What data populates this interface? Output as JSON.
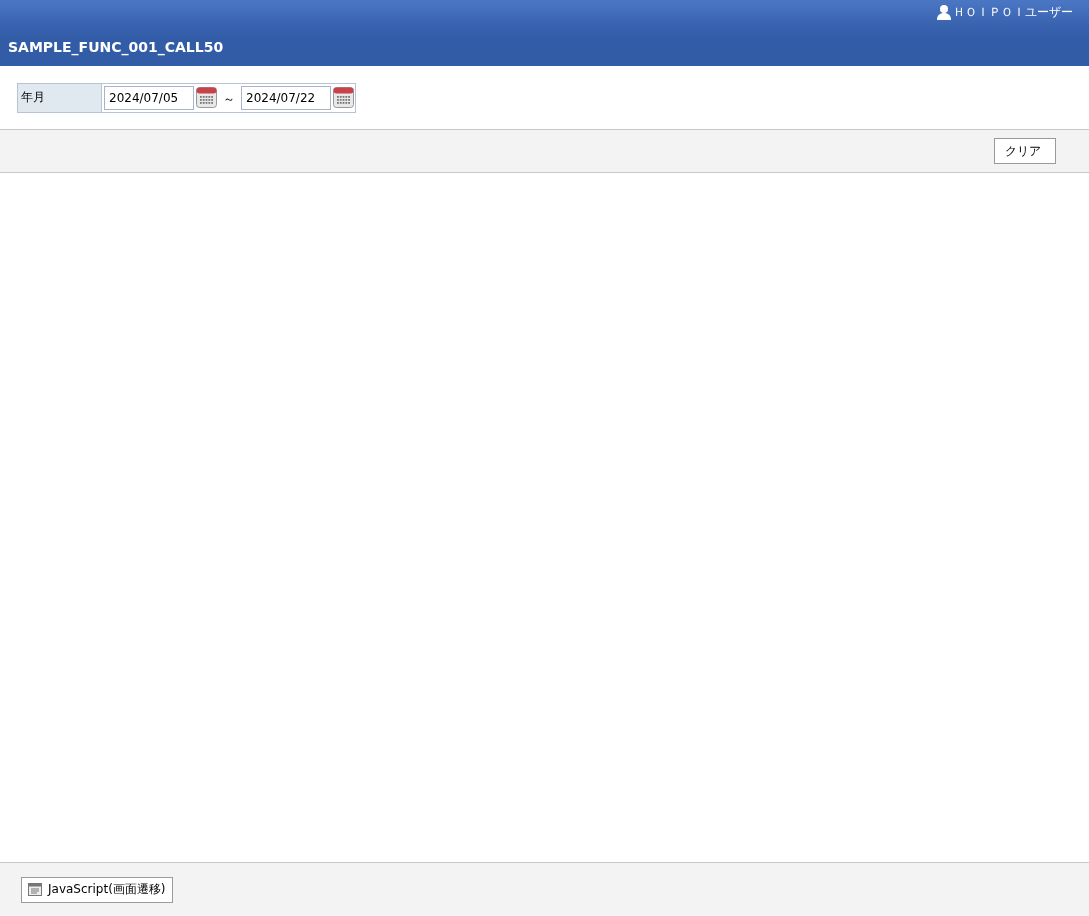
{
  "header": {
    "user_name": "ＨＯＩＰＯＩユーザー",
    "title": "SAMPLE_FUNC_001_CALL50"
  },
  "search": {
    "label": "年月",
    "from": "2024/07/05",
    "separator": "～",
    "to": "2024/07/22"
  },
  "toolbar": {
    "buttons": [
      "クリア"
    ]
  },
  "footer": {
    "buttons": [
      "JavaScript(画面遷移)"
    ]
  }
}
